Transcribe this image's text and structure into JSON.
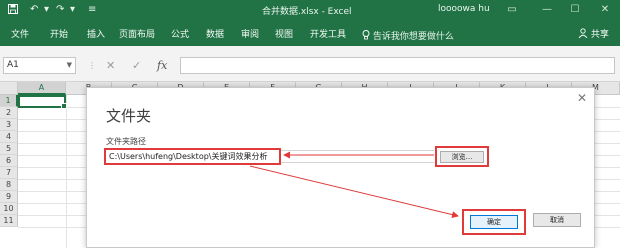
{
  "titlebar": {
    "title": "合并数据.xlsx - Excel",
    "user": "loooowa hu",
    "save_icon": "save-icon",
    "undo_icon": "undo-icon",
    "redo_icon": "redo-icon",
    "customize_icon": "customize-qat-icon",
    "ribbon_display_icon": "ribbon-display-icon",
    "minimize_icon": "minimize-icon",
    "restore_icon": "restore-icon",
    "close_icon": "close-icon"
  },
  "ribbon": {
    "tabs": [
      "文件",
      "开始",
      "插入",
      "页面布局",
      "公式",
      "数据",
      "审阅",
      "视图",
      "开发工具"
    ],
    "tell_me": "告诉我你想要做什么",
    "share": "共享",
    "lightbulb_icon": "lightbulb-icon",
    "person_icon": "person-icon"
  },
  "formula_bar": {
    "name_box": "A1",
    "formula": "",
    "fx_label": "fx"
  },
  "grid": {
    "columns": [
      "A",
      "B",
      "C",
      "D",
      "E",
      "F",
      "G",
      "H",
      "I",
      "J",
      "K",
      "L",
      "M"
    ],
    "rows": [
      "1",
      "2",
      "3",
      "4",
      "5",
      "6",
      "7",
      "8",
      "9",
      "10",
      "11"
    ],
    "selected_cell": "A1"
  },
  "dialog": {
    "title": "文件夹",
    "path_label": "文件夹路径",
    "path_value": "C:\\Users\\hufeng\\Desktop\\关键词效果分析",
    "browse_label": "浏览...",
    "ok_label": "确定",
    "cancel_label": "取消",
    "close_glyph": "✕"
  },
  "colors": {
    "excel_green": "#217346",
    "annotation_red": "#e03a3a",
    "primary_button_border": "#0078d7"
  }
}
